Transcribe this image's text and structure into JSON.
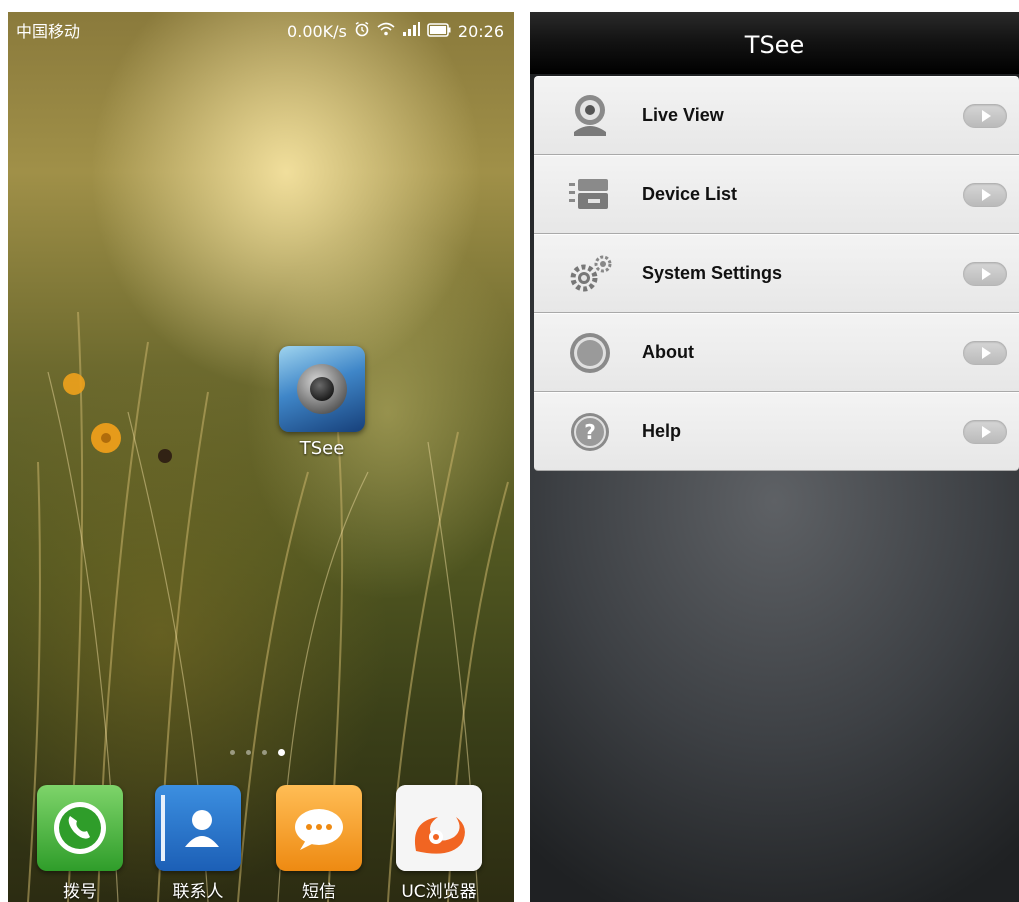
{
  "left_screen": {
    "status_bar": {
      "carrier": "中国移动",
      "net_speed": "0.00K/s",
      "time": "20:26"
    },
    "desktop_apps": [
      {
        "label": "TSee",
        "icon": "tsee-camera-icon"
      }
    ],
    "page_indicator": {
      "total": 4,
      "active_index": 3
    },
    "dock": [
      {
        "label": "拨号",
        "icon": "phone-icon"
      },
      {
        "label": "联系人",
        "icon": "contacts-icon"
      },
      {
        "label": "短信",
        "icon": "sms-icon"
      },
      {
        "label": "UC浏览器",
        "icon": "uc-browser-icon"
      }
    ]
  },
  "right_screen": {
    "title": "TSee",
    "menu": [
      {
        "label": "Live View",
        "icon": "webcam-icon"
      },
      {
        "label": "Device List",
        "icon": "device-list-icon"
      },
      {
        "label": "System Settings",
        "icon": "gears-icon"
      },
      {
        "label": "About",
        "icon": "about-circle-icon"
      },
      {
        "label": "Help",
        "icon": "help-icon"
      }
    ]
  },
  "colors": {
    "menu_background": "#ececec",
    "title_bar": "#000000",
    "app_background": "#3d4044",
    "text_on_dark": "#ffffff"
  }
}
